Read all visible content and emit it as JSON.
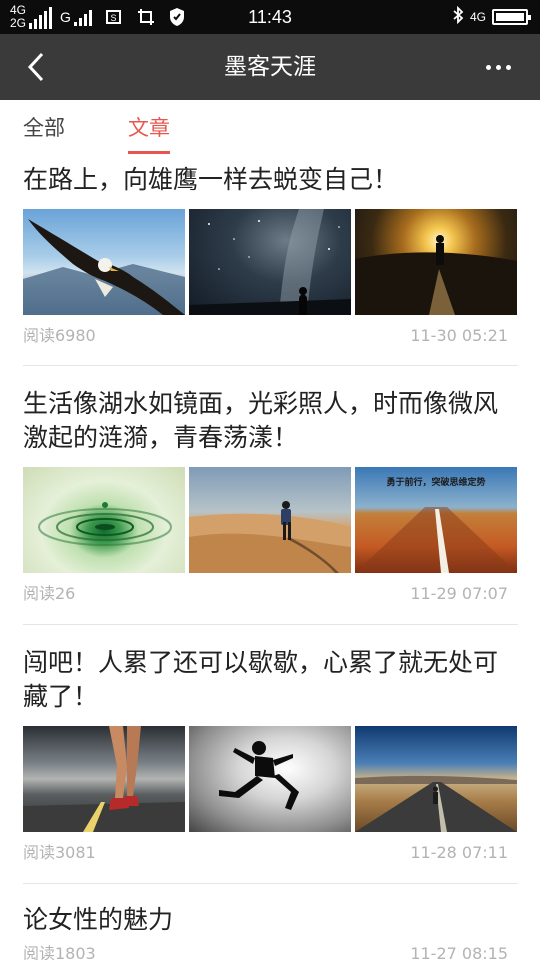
{
  "status_bar": {
    "net_top": "4G",
    "net_bottom": "2G",
    "net_g": "G",
    "time": "11:43",
    "net_right": "4G"
  },
  "nav": {
    "title": "墨客天涯"
  },
  "tabs": [
    {
      "label": "全部",
      "active": false
    },
    {
      "label": "文章",
      "active": true
    }
  ],
  "accent_color": "#e7574f",
  "articles": [
    {
      "title": "在路上，向雄鹰一样去蜕变自己！",
      "thumbs": [
        "eagle-photo",
        "milky-way-photo",
        "sunset-figure-photo"
      ],
      "reads": "阅读6980",
      "date": "11-30 05:21"
    },
    {
      "title": "生活像湖水如镜面，光彩照人，时而像微风激起的涟漪，青春荡漾！",
      "thumbs": [
        "water-ripple-photo",
        "desert-hiker-photo",
        "motion-road-photo"
      ],
      "thumb_caption": "勇于前行，突破思维定势",
      "reads": "阅读26",
      "date": "11-29 07:07"
    },
    {
      "title": "闯吧！人累了还可以歇歇，心累了就无处可藏了！",
      "thumbs": [
        "runner-legs-photo",
        "jumping-silhouette-photo",
        "highway-walker-photo"
      ],
      "reads": "阅读3081",
      "date": "11-28 07:11"
    },
    {
      "title": "论女性的魅力",
      "reads": "阅读1803",
      "date": "11-27 08:15"
    }
  ]
}
